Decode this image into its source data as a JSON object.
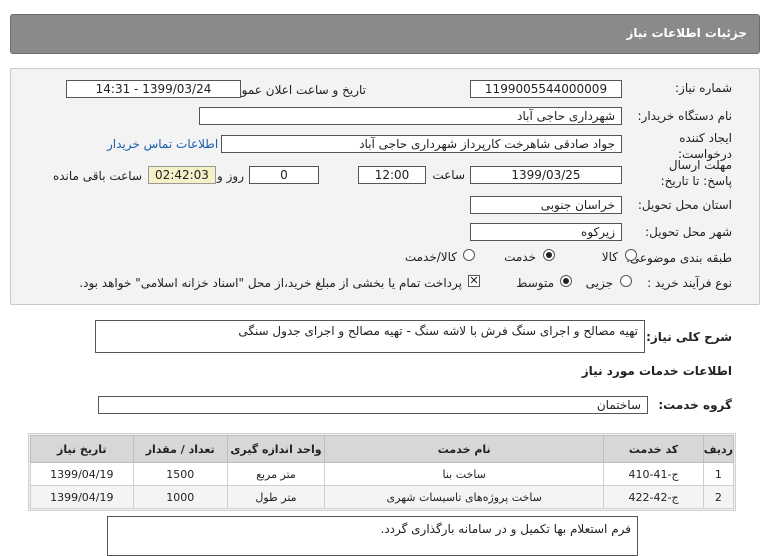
{
  "header": {
    "title": "جزئیات اطلاعات نیاز"
  },
  "form": {
    "need_number_label": "شماره نیاز:",
    "need_number": "1199005544000009",
    "announce_label": "تاریخ و ساعت اعلان عمومی:",
    "announce_value": "1399/03/24 - 14:31",
    "buyer_org_label": "نام دستگاه خریدار:",
    "buyer_org": "شهرداری حاجی آباد",
    "creator_label": "ایجاد کننده درخواست:",
    "creator": "جواد صادقی شاهرخت کارپرداز شهرداری حاجی آباد",
    "contact_link": "اطلاعات تماس خریدار",
    "deadline_label": "مهلت ارسال پاسخ: تا تاریخ:",
    "deadline_date": "1399/03/25",
    "time_label": "ساعت",
    "deadline_time": "12:00",
    "days_value": "0",
    "days_label": "روز و",
    "remaining_time": "02:42:03",
    "remaining_label": "ساعت باقی مانده",
    "province_label": "استان محل تحویل:",
    "province": "خراسان جنوبی",
    "city_label": "شهر محل تحویل:",
    "city": "زیرکوه",
    "category_label": "طبقه بندی موضوعی:",
    "category_options": [
      "کالا",
      "خدمت",
      "کالا/خدمت"
    ],
    "category_selected": "خدمت",
    "process_label": "نوع فرآیند خرید :",
    "process_options": [
      "جزیی",
      "متوسط"
    ],
    "process_selected": "متوسط",
    "payment_note": "پرداخت تمام یا بخشی از مبلغ خرید،از محل \"اسناد خزانه اسلامی\" خواهد بود."
  },
  "description": {
    "label": "شرح کلی نیاز:",
    "text": "تهیه مصالح و اجرای سنگ فرش با لاشه سنگ - تهیه مصالح و اجرای جدول سنگی"
  },
  "services": {
    "section_title": "اطلاعات خدمات مورد نیاز",
    "group_label": "گروه خدمت:",
    "group_value": "ساختمان",
    "columns": [
      "ردیف",
      "کد خدمت",
      "نام خدمت",
      "واحد اندازه گیری",
      "تعداد / مقدار",
      "تاریخ نیاز"
    ],
    "rows": [
      {
        "row": "1",
        "code": "ج-41-410",
        "name": "ساخت بنا",
        "unit": "متر مربع",
        "qty": "1500",
        "date": "1399/04/19"
      },
      {
        "row": "2",
        "code": "ج-42-422",
        "name": "ساخت پروژه‌های تاسیسات شهری",
        "unit": "متر طول",
        "qty": "1000",
        "date": "1399/04/19"
      }
    ]
  },
  "buyer_notes": {
    "text": "فرم استعلام بها تکمیل و در سامانه بارگذاری گردد."
  }
}
